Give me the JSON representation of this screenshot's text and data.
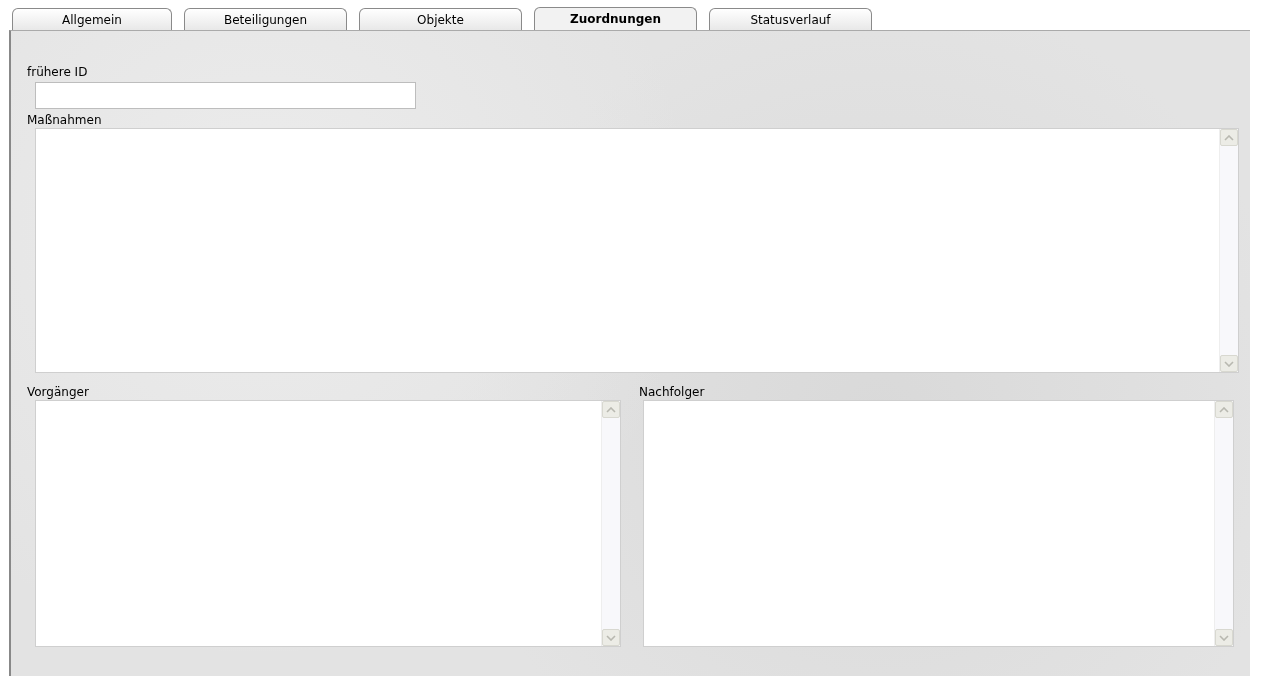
{
  "tabs": [
    {
      "label": "Allgemein",
      "selected": false
    },
    {
      "label": "Beteiligungen",
      "selected": false
    },
    {
      "label": "Objekte",
      "selected": false
    },
    {
      "label": "Zuordnungen",
      "selected": true
    },
    {
      "label": "Statusverlauf",
      "selected": false
    }
  ],
  "fields": [
    {
      "label": "frühere ID",
      "kind": "line"
    },
    {
      "label": "Maßnahmen",
      "kind": "area"
    }
  ],
  "lower_fields": [
    {
      "label": "Vorgänger",
      "kind": "area"
    },
    {
      "label": "Nachfolger",
      "kind": "area"
    }
  ]
}
